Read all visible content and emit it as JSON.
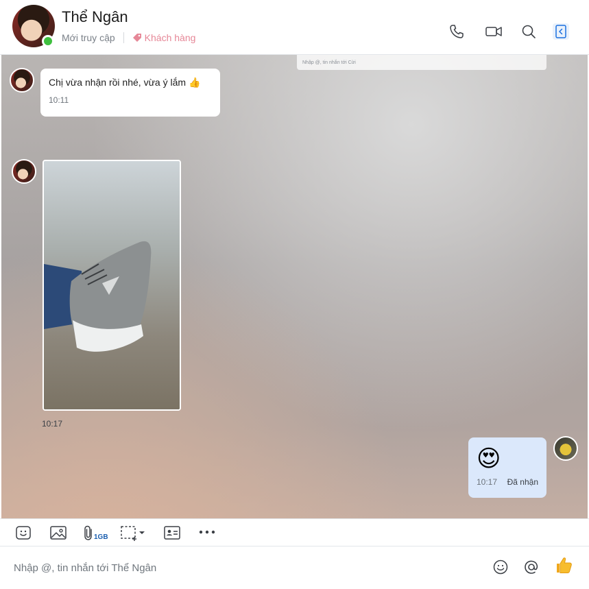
{
  "header": {
    "contact_name": "Thể Ngân",
    "status": "Mới truy cập",
    "tag": "Khách hàng",
    "icons": [
      "phone-icon",
      "video-icon",
      "search-icon",
      "panel-toggle-icon"
    ]
  },
  "chat": {
    "ghost_input_placeholder": "Nhập @, tin nhắn tới Cừi",
    "messages": [
      {
        "sender": "Thể Ngân",
        "text": "Chị vừa nhận rồi nhé, vừa ý lắm 👍",
        "time": "10:11"
      },
      {
        "sender": "Thể Ngân",
        "type": "image",
        "alt": "photo",
        "time": "10:17"
      },
      {
        "sender": "me",
        "text": "😍",
        "time": "10:17",
        "status": "Đã nhận"
      }
    ]
  },
  "toolbar": {
    "attach_size": "1GB",
    "icons": [
      "sticker-icon",
      "image-icon",
      "attach-icon",
      "screenshot-icon",
      "contact-card-icon",
      "more-icon"
    ]
  },
  "composer": {
    "placeholder": "Nhập @, tin nhắn tới Thể Ngân",
    "icons": [
      "emoji-icon",
      "mention-icon",
      "thumbs-up-icon"
    ]
  },
  "colors": {
    "accent": "#0068ff",
    "online": "#3fbf3f",
    "tag": "#e68797",
    "my_bubble": "#dbe8fb"
  }
}
